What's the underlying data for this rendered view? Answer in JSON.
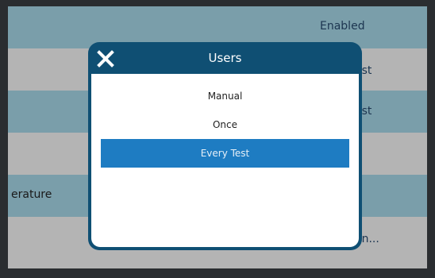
{
  "background_rows": [
    {
      "label": "",
      "value": "Enabled"
    },
    {
      "label": "",
      "value": "est"
    },
    {
      "label": "",
      "value": "est"
    },
    {
      "label": "",
      "value": ""
    },
    {
      "label": "erature",
      "value": ""
    },
    {
      "label": "",
      "value": "on..."
    }
  ],
  "dialog": {
    "title": "Users",
    "close_icon": "close-icon",
    "options": [
      "Manual",
      "Once",
      "Every Test"
    ],
    "selected_option": "Every Test"
  },
  "colors": {
    "header": "#0f4f73",
    "selected": "#1e7cc2",
    "row_blue": "#7a9eaa",
    "row_gray": "#b4b4b4"
  }
}
